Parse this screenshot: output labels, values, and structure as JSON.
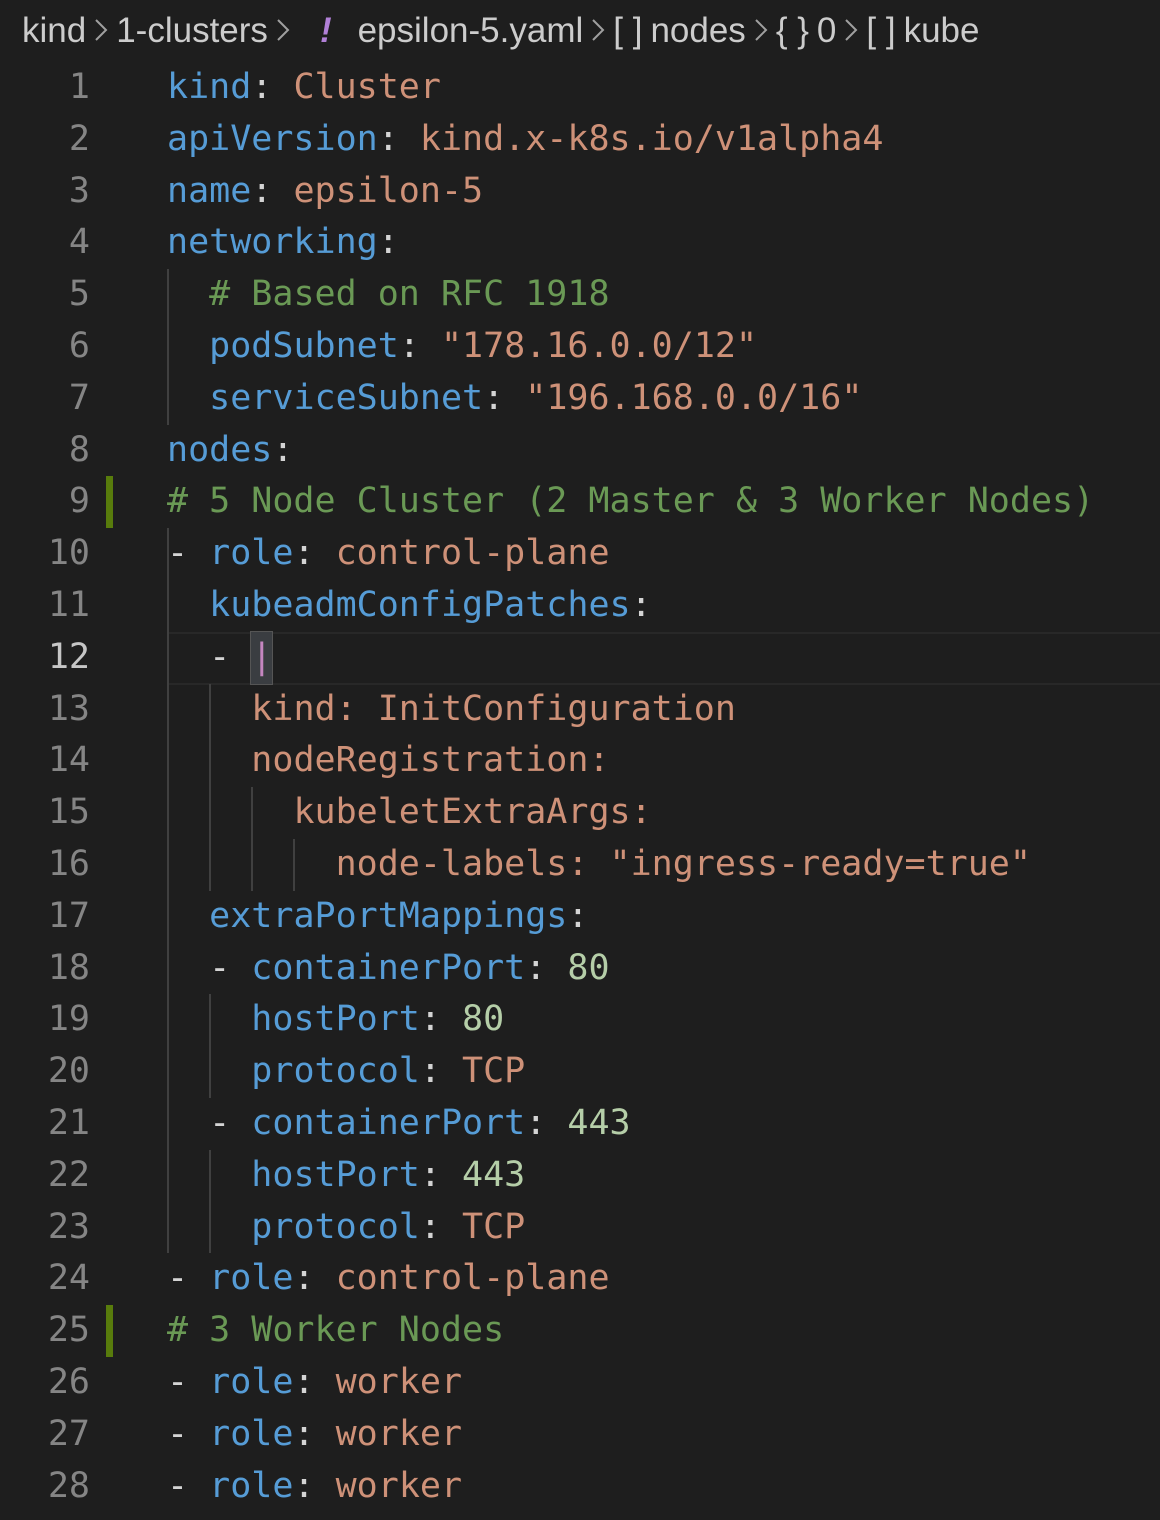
{
  "breadcrumb": {
    "items": [
      {
        "symbol": "",
        "label": "kind"
      },
      {
        "symbol": "",
        "label": "1-clusters"
      },
      {
        "symbol": "!",
        "label": "epsilon-5.yaml"
      },
      {
        "symbol": "[ ]",
        "label": "nodes"
      },
      {
        "symbol": "{ }",
        "label": "0"
      },
      {
        "symbol": "[ ]",
        "label": "kube"
      }
    ]
  },
  "editor": {
    "active_line": 12,
    "lines": [
      {
        "num": "1",
        "tokens": [
          [
            "k",
            "kind"
          ],
          [
            "p",
            ": "
          ],
          [
            "s",
            "Cluster"
          ]
        ]
      },
      {
        "num": "2",
        "tokens": [
          [
            "k",
            "apiVersion"
          ],
          [
            "p",
            ": "
          ],
          [
            "s",
            "kind.x-k8s.io/v1alpha4"
          ]
        ]
      },
      {
        "num": "3",
        "tokens": [
          [
            "k",
            "name"
          ],
          [
            "p",
            ": "
          ],
          [
            "s",
            "epsilon-5"
          ]
        ]
      },
      {
        "num": "4",
        "tokens": [
          [
            "k",
            "networking"
          ],
          [
            "p",
            ":"
          ]
        ]
      },
      {
        "num": "5",
        "tokens": [
          [
            "p",
            "  "
          ],
          [
            "c",
            "# Based on RFC 1918"
          ]
        ]
      },
      {
        "num": "6",
        "tokens": [
          [
            "p",
            "  "
          ],
          [
            "k",
            "podSubnet"
          ],
          [
            "p",
            ": "
          ],
          [
            "s",
            "\"178.16.0.0/12\""
          ]
        ]
      },
      {
        "num": "7",
        "tokens": [
          [
            "p",
            "  "
          ],
          [
            "k",
            "serviceSubnet"
          ],
          [
            "p",
            ": "
          ],
          [
            "s",
            "\"196.168.0.0/16\""
          ]
        ]
      },
      {
        "num": "8",
        "tokens": [
          [
            "k",
            "nodes"
          ],
          [
            "p",
            ":"
          ]
        ]
      },
      {
        "num": "9",
        "tokens": [
          [
            "c",
            "# 5 Node Cluster (2 Master & 3 Worker Nodes)"
          ]
        ]
      },
      {
        "num": "10",
        "tokens": [
          [
            "p",
            "- "
          ],
          [
            "k",
            "role"
          ],
          [
            "p",
            ": "
          ],
          [
            "s",
            "control-plane"
          ]
        ]
      },
      {
        "num": "11",
        "tokens": [
          [
            "p",
            "  "
          ],
          [
            "k",
            "kubeadmConfigPatches"
          ],
          [
            "p",
            ":"
          ]
        ]
      },
      {
        "num": "12",
        "tokens": [
          [
            "p",
            "  - "
          ],
          [
            "cursor",
            "|"
          ]
        ]
      },
      {
        "num": "13",
        "tokens": [
          [
            "p",
            "    "
          ],
          [
            "s",
            "kind: InitConfiguration"
          ]
        ]
      },
      {
        "num": "14",
        "tokens": [
          [
            "p",
            "    "
          ],
          [
            "s",
            "nodeRegistration:"
          ]
        ]
      },
      {
        "num": "15",
        "tokens": [
          [
            "p",
            "      "
          ],
          [
            "s",
            "kubeletExtraArgs:"
          ]
        ]
      },
      {
        "num": "16",
        "tokens": [
          [
            "p",
            "        "
          ],
          [
            "s",
            "node-labels: \"ingress-ready=true\""
          ]
        ]
      },
      {
        "num": "17",
        "tokens": [
          [
            "p",
            "  "
          ],
          [
            "k",
            "extraPortMappings"
          ],
          [
            "p",
            ":"
          ]
        ]
      },
      {
        "num": "18",
        "tokens": [
          [
            "p",
            "  - "
          ],
          [
            "k",
            "containerPort"
          ],
          [
            "p",
            ": "
          ],
          [
            "n",
            "80"
          ]
        ]
      },
      {
        "num": "19",
        "tokens": [
          [
            "p",
            "    "
          ],
          [
            "k",
            "hostPort"
          ],
          [
            "p",
            ": "
          ],
          [
            "n",
            "80"
          ]
        ]
      },
      {
        "num": "20",
        "tokens": [
          [
            "p",
            "    "
          ],
          [
            "k",
            "protocol"
          ],
          [
            "p",
            ": "
          ],
          [
            "s",
            "TCP"
          ]
        ]
      },
      {
        "num": "21",
        "tokens": [
          [
            "p",
            "  - "
          ],
          [
            "k",
            "containerPort"
          ],
          [
            "p",
            ": "
          ],
          [
            "n",
            "443"
          ]
        ]
      },
      {
        "num": "22",
        "tokens": [
          [
            "p",
            "    "
          ],
          [
            "k",
            "hostPort"
          ],
          [
            "p",
            ": "
          ],
          [
            "n",
            "443"
          ]
        ]
      },
      {
        "num": "23",
        "tokens": [
          [
            "p",
            "    "
          ],
          [
            "k",
            "protocol"
          ],
          [
            "p",
            ": "
          ],
          [
            "s",
            "TCP"
          ]
        ]
      },
      {
        "num": "24",
        "tokens": [
          [
            "p",
            "- "
          ],
          [
            "k",
            "role"
          ],
          [
            "p",
            ": "
          ],
          [
            "s",
            "control-plane"
          ]
        ]
      },
      {
        "num": "25",
        "tokens": [
          [
            "c",
            "# 3 Worker Nodes"
          ]
        ]
      },
      {
        "num": "26",
        "tokens": [
          [
            "p",
            "- "
          ],
          [
            "k",
            "role"
          ],
          [
            "p",
            ": "
          ],
          [
            "s",
            "worker"
          ]
        ]
      },
      {
        "num": "27",
        "tokens": [
          [
            "p",
            "- "
          ],
          [
            "k",
            "role"
          ],
          [
            "p",
            ": "
          ],
          [
            "s",
            "worker"
          ]
        ]
      },
      {
        "num": "28",
        "tokens": [
          [
            "p",
            "- "
          ],
          [
            "k",
            "role"
          ],
          [
            "p",
            ": "
          ],
          [
            "s",
            "worker"
          ]
        ]
      }
    ],
    "modified_lines": [
      9,
      25
    ]
  },
  "colors": {
    "background": "#1e1e1e",
    "key": "#569cd6",
    "string": "#ce9178",
    "number": "#b5cea8",
    "comment": "#6a9955",
    "line_number": "#858585",
    "warning_icon": "#b180d7",
    "gutter_modified": "#587c0c"
  }
}
